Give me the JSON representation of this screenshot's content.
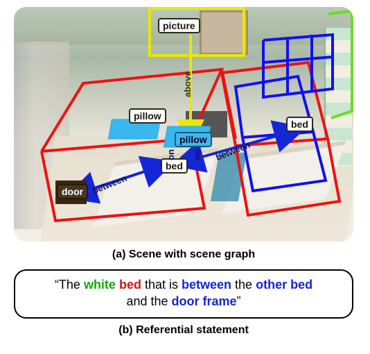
{
  "scene": {
    "node_labels": {
      "picture": "picture",
      "pillow_left": "pillow",
      "pillow_center": "pillow",
      "bed_center": "bed",
      "bed_right": "bed",
      "door": "door"
    },
    "edge_labels": {
      "above": "above",
      "on_left": "on",
      "on_right": "on",
      "between_left": "between",
      "between_right": "between"
    }
  },
  "captions": {
    "a": "(a)  Scene with scene graph",
    "b": "(b) Referential statement"
  },
  "referential": {
    "open_quote": "“",
    "the1": "The ",
    "white": "white",
    "sp1": " ",
    "bed": "bed",
    "mid1": " that is ",
    "between": "between",
    "mid2": " the ",
    "other_bed": "other bed",
    "line2_lead": "and the ",
    "door_frame": "door frame",
    "close_quote": "”"
  }
}
